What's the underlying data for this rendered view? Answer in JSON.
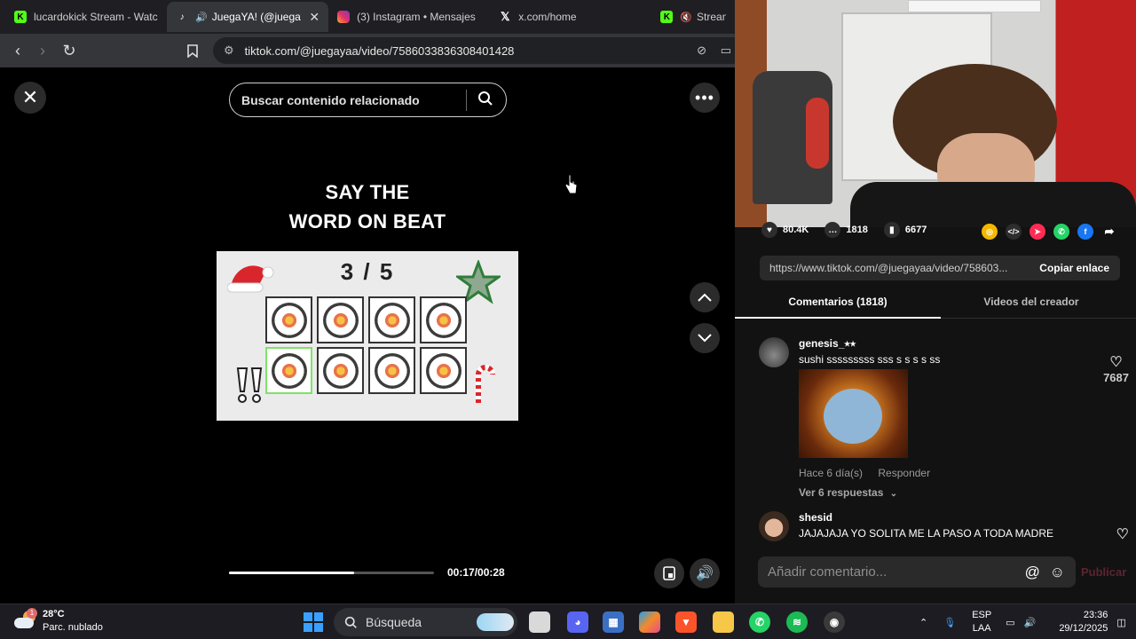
{
  "browser": {
    "tabs": [
      {
        "label": "lucardokick Stream - Watch",
        "icon": "kick-icon",
        "active": false
      },
      {
        "label": "JuegaYA! (@juegaya",
        "icon": "tiktok-icon",
        "active": true
      },
      {
        "label": "(3) Instagram • Mensajes",
        "icon": "instagram-icon",
        "active": false
      },
      {
        "label": "x.com/home",
        "icon": "x-icon",
        "active": false
      },
      {
        "label": "Stream - I",
        "icon": "kick-icon",
        "active": false
      }
    ],
    "url": "tiktok.com/@juegayaa/video/7586033836308401428"
  },
  "video": {
    "search_placeholder": "Buscar contenido relacionado",
    "title_line1": "SAY THE",
    "title_line2": "WORD ON BEAT",
    "counter": "3 / 5",
    "progress": 0.61,
    "time": "00:17/00:28"
  },
  "stats": {
    "likes": "80.4K",
    "comments": "1818",
    "saves": "6677"
  },
  "share": {
    "link": "https://www.tiktok.com/@juegayaa/video/758603...",
    "copy_label": "Copiar enlace"
  },
  "side_tabs": {
    "comments": "Comentarios (1818)",
    "creator_videos": "Videos del creador"
  },
  "comments": [
    {
      "user": "genesis_⭑⭑",
      "text": "sushi sssssssss sss s s s s ss",
      "time": "Hace 6 día(s)",
      "reply": "Responder",
      "replies": "Ver 6 respuestas",
      "likes": "7687"
    },
    {
      "user": "shesid",
      "text": "JAJAJAJA YO SOLITA ME LA PASO A TODA MADRE"
    }
  ],
  "comment_box": {
    "placeholder": "Añadir comentario...",
    "publish": "Publicar"
  },
  "taskbar": {
    "temp": "28°C",
    "weather": "Parc. nublado",
    "search": "Búsqueda",
    "lang1": "ESP",
    "lang2": "LAA",
    "time": "23:36",
    "date": "29/12/2025"
  },
  "colors": {
    "accent_publish": "#fe2c55",
    "highlight": "#7fe26a"
  }
}
